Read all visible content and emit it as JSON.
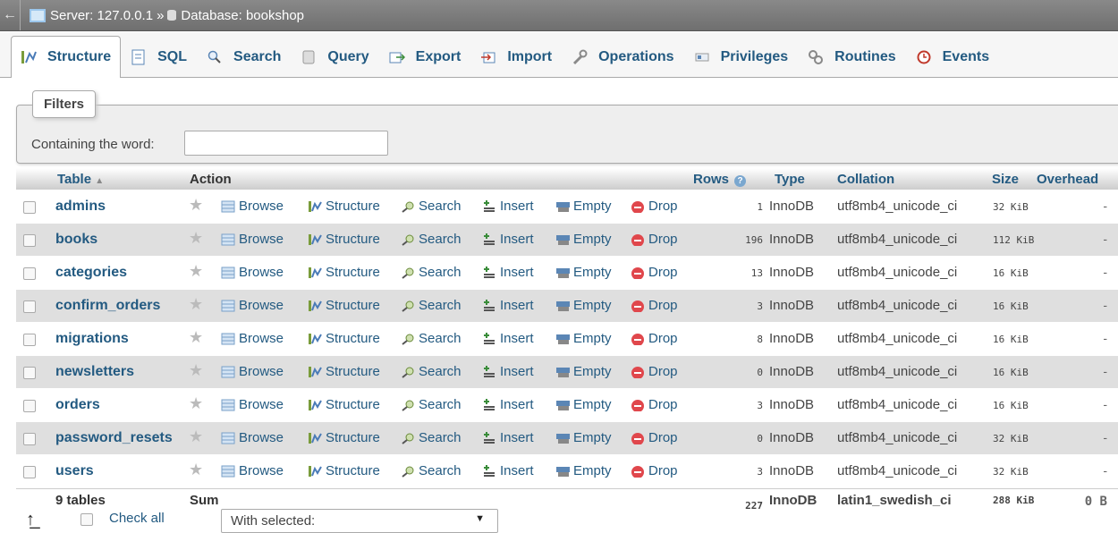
{
  "breadcrumb": {
    "server": "Server: 127.0.0.1",
    "separator": "»",
    "database": "Database: bookshop"
  },
  "tabs": [
    {
      "label": "Structure",
      "icon": "structure-icon"
    },
    {
      "label": "SQL",
      "icon": "sql-icon"
    },
    {
      "label": "Search",
      "icon": "search-icon"
    },
    {
      "label": "Query",
      "icon": "query-icon"
    },
    {
      "label": "Export",
      "icon": "export-icon"
    },
    {
      "label": "Import",
      "icon": "import-icon"
    },
    {
      "label": "Operations",
      "icon": "wrench-icon"
    },
    {
      "label": "Privileges",
      "icon": "privileges-icon"
    },
    {
      "label": "Routines",
      "icon": "routines-icon"
    },
    {
      "label": "Events",
      "icon": "clock-icon"
    }
  ],
  "filters": {
    "legend": "Filters",
    "label": "Containing the word:",
    "value": ""
  },
  "table": {
    "headers": {
      "table": "Table",
      "action": "Action",
      "rows": "Rows",
      "type": "Type",
      "collation": "Collation",
      "size": "Size",
      "overhead": "Overhead"
    },
    "actions": {
      "browse": "Browse",
      "structure": "Structure",
      "search": "Search",
      "insert": "Insert",
      "empty": "Empty",
      "drop": "Drop"
    },
    "rows": [
      {
        "name": "admins",
        "rows": "1",
        "type": "InnoDB",
        "collation": "utf8mb4_unicode_ci",
        "size": "32 KiB",
        "overhead": "-"
      },
      {
        "name": "books",
        "rows": "196",
        "type": "InnoDB",
        "collation": "utf8mb4_unicode_ci",
        "size": "112 KiB",
        "overhead": "-"
      },
      {
        "name": "categories",
        "rows": "13",
        "type": "InnoDB",
        "collation": "utf8mb4_unicode_ci",
        "size": "16 KiB",
        "overhead": "-"
      },
      {
        "name": "confirm_orders",
        "rows": "3",
        "type": "InnoDB",
        "collation": "utf8mb4_unicode_ci",
        "size": "16 KiB",
        "overhead": "-"
      },
      {
        "name": "migrations",
        "rows": "8",
        "type": "InnoDB",
        "collation": "utf8mb4_unicode_ci",
        "size": "16 KiB",
        "overhead": "-"
      },
      {
        "name": "newsletters",
        "rows": "0",
        "type": "InnoDB",
        "collation": "utf8mb4_unicode_ci",
        "size": "16 KiB",
        "overhead": "-"
      },
      {
        "name": "orders",
        "rows": "3",
        "type": "InnoDB",
        "collation": "utf8mb4_unicode_ci",
        "size": "16 KiB",
        "overhead": "-"
      },
      {
        "name": "password_resets",
        "rows": "0",
        "type": "InnoDB",
        "collation": "utf8mb4_unicode_ci",
        "size": "32 KiB",
        "overhead": "-"
      },
      {
        "name": "users",
        "rows": "3",
        "type": "InnoDB",
        "collation": "utf8mb4_unicode_ci",
        "size": "32 KiB",
        "overhead": "-"
      }
    ],
    "footer": {
      "count": "9 tables",
      "sum": "Sum",
      "rows": "227",
      "type": "InnoDB",
      "collation": "latin1_swedish_ci",
      "size": "288 KiB",
      "overhead": "0 B"
    }
  },
  "bottom": {
    "check_all": "Check all",
    "with_selected": "With selected:"
  },
  "colors": {
    "link": "#235a81",
    "row_alt": "#dfdfdf",
    "drop": "#e0474c"
  }
}
